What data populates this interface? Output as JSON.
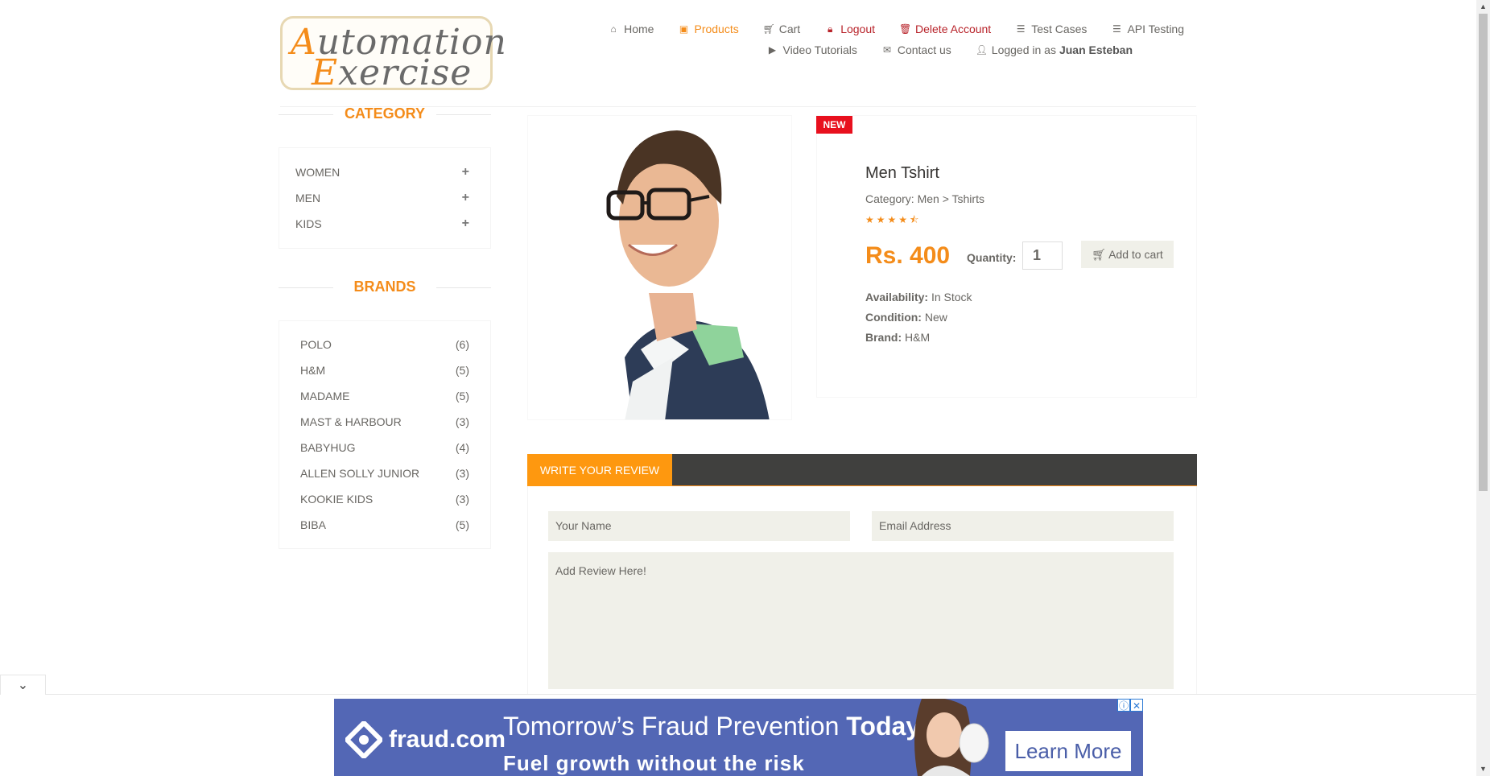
{
  "header": {
    "logo_text_1": "Automation",
    "logo_text_2": "Exercise",
    "nav_row1": [
      {
        "label": "Home",
        "icon": "home-icon"
      },
      {
        "label": "Products",
        "icon": "products-icon"
      },
      {
        "label": "Cart",
        "icon": "cart-icon"
      },
      {
        "label": "Logout",
        "icon": "lock-icon"
      },
      {
        "label": "Delete Account",
        "icon": "trash-icon"
      },
      {
        "label": "Test Cases",
        "icon": "list-icon"
      },
      {
        "label": "API Testing",
        "icon": "list-icon"
      }
    ],
    "nav_row2": [
      {
        "label": "Video Tutorials",
        "icon": "youtube-icon"
      },
      {
        "label": "Contact us",
        "icon": "envelope-icon"
      },
      {
        "label": "Logged in as",
        "icon": "user-icon",
        "user": "Juan Esteban"
      }
    ]
  },
  "sidebar": {
    "category_title": "CATEGORY",
    "categories": [
      "WOMEN",
      "MEN",
      "KIDS"
    ],
    "brands_title": "BRANDS",
    "brands": [
      {
        "name": "POLO",
        "count": "(6)"
      },
      {
        "name": "H&M",
        "count": "(5)"
      },
      {
        "name": "MADAME",
        "count": "(5)"
      },
      {
        "name": "MAST & HARBOUR",
        "count": "(3)"
      },
      {
        "name": "BABYHUG",
        "count": "(4)"
      },
      {
        "name": "ALLEN SOLLY JUNIOR",
        "count": "(3)"
      },
      {
        "name": "KOOKIE KIDS",
        "count": "(3)"
      },
      {
        "name": "BIBA",
        "count": "(5)"
      }
    ]
  },
  "product": {
    "badge": "NEW",
    "name": "Men Tshirt",
    "category": "Category: Men > Tshirts",
    "rating": 4.5,
    "stars": "★★★★⯪",
    "price": "Rs. 400",
    "quantity_label": "Quantity:",
    "quantity": "1",
    "add_to_cart": "Add to cart",
    "availability_label": "Availability:",
    "availability": "In Stock",
    "condition_label": "Condition:",
    "condition": "New",
    "brand_label": "Brand:",
    "brand": "H&M"
  },
  "review": {
    "tab_label": "WRITE YOUR REVIEW",
    "name_placeholder": "Your Name",
    "email_placeholder": "Email Address",
    "review_placeholder": "Add Review Here!"
  },
  "ad": {
    "brand": "fraud.com",
    "headline": "Tomorrow’s Fraud Prevention",
    "headline_bold": "Today",
    "subline": "Fuel growth without the risk",
    "cta": "Learn More"
  },
  "colors": {
    "accent": "#f48c1a",
    "danger": "#b8232a",
    "review_tab": "#fe980f",
    "ad_bg": "#5367b5"
  }
}
